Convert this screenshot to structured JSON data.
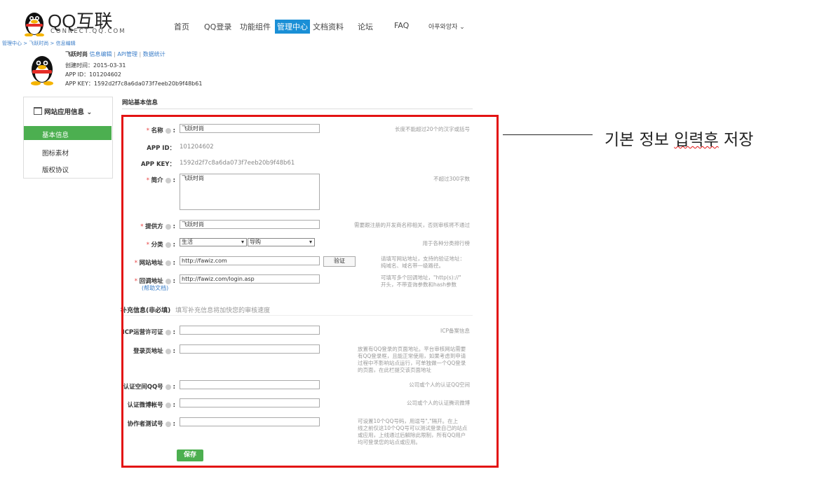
{
  "header": {
    "logo_main": "QQ互联",
    "logo_sub": "CONNECT.QQ.COM",
    "nav": [
      "首页",
      "QQ登录",
      "功能组件",
      "管理中心",
      "文档资料",
      "论坛",
      "FAQ"
    ],
    "user": "아푸와앙자 ⌄"
  },
  "breadcrumb": "管理中心 > 飞跃时尚 > 信息编辑",
  "app": {
    "name": "飞跃时尚",
    "links": [
      "信息编辑",
      "API管理",
      "数据统计"
    ],
    "created": "创建时间：2015-03-31",
    "app_id_line": "APP ID：101204602",
    "app_key_line": "APP KEY：1592d2f7c8a6da073f7eeb20b9f48b61"
  },
  "sidebar": {
    "title": "网站应用信息",
    "items": [
      "基本信息",
      "图标素材",
      "版权协议"
    ]
  },
  "section_title": "网站基本信息",
  "form": {
    "name_label": "名称",
    "name_value": "飞跃时尚",
    "name_hint": "长度不能超过20个的汉字或括号",
    "appid_label": "APP ID：",
    "appid_value": "101204602",
    "appkey_label": "APP KEY：",
    "appkey_value": "1592d2f7c8a6da073f7eeb20b9f48b61",
    "intro_label": "简介",
    "intro_value": "飞跃时尚",
    "intro_hint": "不超过300字数",
    "provider_label": "提供方",
    "provider_value": "飞跃时尚",
    "provider_hint": "需要跟注册的开发商名称相关，否则审核将不通过",
    "category_label": "分类",
    "category_1": "生活",
    "category_2": "导购",
    "category_hint": "用于各种分类排行榜",
    "site_label": "网站地址",
    "site_value": "http://fawiz.com",
    "verify_button": "验证",
    "site_hint_1": "请填写网站地址，支持的验证地址：",
    "site_hint_2": "纯域名、域名带一级路径。",
    "callback_label": "回调地址",
    "callback_help": "(帮助文档)",
    "callback_value": "http://fawiz.com/login.asp",
    "callback_hint_1": "可填写多个回调地址，\"http(s)://\"",
    "callback_hint_2": "开头，不带查询参数和hash参数"
  },
  "extra": {
    "title": "补充信息(非必填)",
    "subtitle": "填写补充信息将加快您的审核速度",
    "icp_label": "ICP运营许可证",
    "icp_hint": "ICP备案信息",
    "login_label": "登录页地址",
    "login_hint": [
      "放置有QQ登录的页面地址。平台审核网站需要",
      "有QQ登录框，且能正常使用，如果考虑到申请",
      "过程中不影响站点运行，可单独做一个QQ登录",
      "的页面，在此栏提交该页面地址"
    ],
    "qzone_label": "认证空间QQ号",
    "qzone_hint": "公司或个人的认证QQ空间",
    "weibo_label": "认证微博帐号",
    "weibo_hint": "公司或个人的认证腾讯微博",
    "tester_label": "协作者测试号",
    "tester_hint": [
      "可设置10个QQ号码，用逗号\",\"隔开。在上",
      "线之前仅这10个QQ号可以测试登录自己的站点",
      "或应用，上线通过后解除此限制，所有QQ用户",
      "均可登录您的站点或应用。"
    ],
    "save_button": "保存"
  },
  "annotation": {
    "part1": "기본 정보 ",
    "part2": "입력후",
    "part3": " 저장"
  },
  "colors": {
    "highlight_border": "#e31313",
    "nav_active": "#1a8fd6",
    "save_green": "#4caf50",
    "sidebar_active": "#4caf50"
  }
}
